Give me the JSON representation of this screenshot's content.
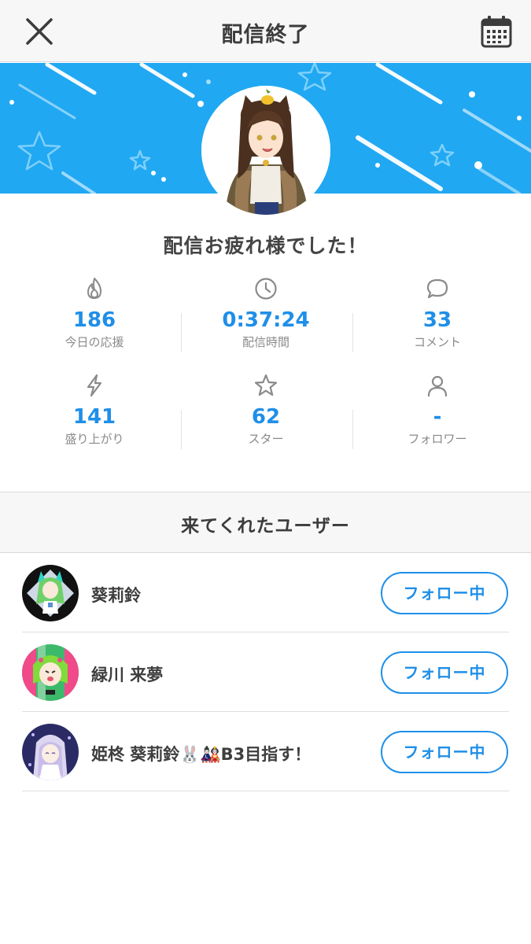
{
  "header": {
    "title": "配信終了",
    "close_icon": "close-icon",
    "calendar_icon": "calendar-icon"
  },
  "colors": {
    "accent": "#1f8fe8",
    "banner": "#21a8f2",
    "header_bg": "#f7f7f8"
  },
  "banner": {
    "decoration": "shooting-stars"
  },
  "summary": {
    "message": "配信お疲れ様でした！"
  },
  "stats": [
    {
      "icon": "flame-icon",
      "value": "186",
      "label": "今日の応援"
    },
    {
      "icon": "clock-icon",
      "value": "0:37:24",
      "label": "配信時間"
    },
    {
      "icon": "speech-bubble-icon",
      "value": "33",
      "label": "コメント"
    },
    {
      "icon": "lightning-icon",
      "value": "141",
      "label": "盛り上がり"
    },
    {
      "icon": "star-icon",
      "value": "62",
      "label": "スター"
    },
    {
      "icon": "person-icon",
      "value": "-",
      "label": "フォロワー"
    }
  ],
  "visitors": {
    "title": "来てくれたユーザー",
    "users": [
      {
        "name": "葵莉鈴",
        "button": "フォロー中"
      },
      {
        "name": "緑川 来夢",
        "button": "フォロー中"
      },
      {
        "name": "姫柊 葵莉鈴🐰🎎B3目指す！",
        "button": "フォロー中"
      }
    ]
  }
}
